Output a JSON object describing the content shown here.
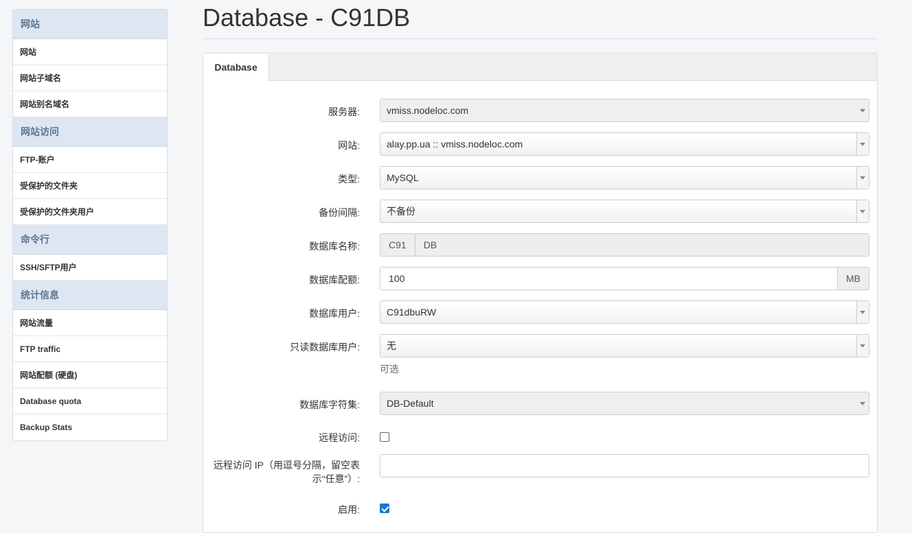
{
  "sidebar": {
    "sections": [
      {
        "title": "网站",
        "items": [
          "网站",
          "网站子域名",
          "网站别名域名"
        ]
      },
      {
        "title": "网站访问",
        "items": [
          "FTP-账户",
          "受保护的文件夹",
          "受保护的文件夹用户"
        ]
      },
      {
        "title": "命令行",
        "items": [
          "SSH/SFTP用户"
        ]
      },
      {
        "title": "统计信息",
        "items": [
          "网站流量",
          "FTP traffic",
          "网站配额 (硬盘)",
          "Database quota",
          "Backup Stats"
        ]
      }
    ]
  },
  "page": {
    "title": "Database - C91DB"
  },
  "tabs": [
    {
      "label": "Database"
    }
  ],
  "form": {
    "server": {
      "label": "服务器:",
      "value": "vmiss.nodeloc.com"
    },
    "website": {
      "label": "网站:",
      "value": "alay.pp.ua :: vmiss.nodeloc.com"
    },
    "type": {
      "label": "类型:",
      "value": "MySQL"
    },
    "backup_interval": {
      "label": "备份间隔:",
      "value": "不备份"
    },
    "db_name": {
      "label": "数据库名称:",
      "prefix": "C91",
      "value": "DB"
    },
    "db_quota": {
      "label": "数据库配额:",
      "value": "100",
      "unit": "MB"
    },
    "db_user": {
      "label": "数据库用户:",
      "value": "C91dbuRW"
    },
    "ro_user": {
      "label": "只读数据库用户:",
      "value": "无",
      "help": "可选"
    },
    "charset": {
      "label": "数据库字符集:",
      "value": "DB-Default"
    },
    "remote_access": {
      "label": "远程访问:",
      "checked": false
    },
    "remote_ip": {
      "label_line1": "远程访问 IP（用逗号分隔，留空表",
      "label_line2": "示“任意”）:",
      "value": ""
    },
    "enabled": {
      "label": "启用:",
      "checked": true
    }
  }
}
